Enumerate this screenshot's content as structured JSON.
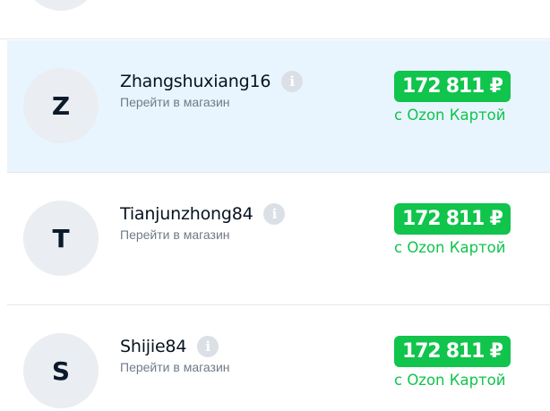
{
  "colors": {
    "highlight_bg": "#e9f5fe",
    "price_green": "#10c44c",
    "avatar_bg": "#eaedf2"
  },
  "sellers": [
    {
      "initial": "Z",
      "name": "Zhangshuxiang16",
      "link_label": "Перейти в магазин",
      "info_icon": "info-icon",
      "price": "172 811 ₽",
      "price_caption": "с Ozon Картой",
      "highlighted": true
    },
    {
      "initial": "T",
      "name": "Tianjunzhong84",
      "link_label": "Перейти в магазин",
      "info_icon": "info-icon",
      "price": "172 811 ₽",
      "price_caption": "с Ozon Картой",
      "highlighted": false
    },
    {
      "initial": "S",
      "name": "Shijie84",
      "link_label": "Перейти в магазин",
      "info_icon": "info-icon",
      "price": "172 811 ₽",
      "price_caption": "с Ozon Картой",
      "highlighted": false
    }
  ]
}
